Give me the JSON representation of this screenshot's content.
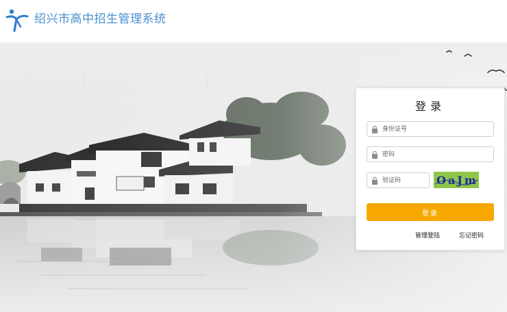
{
  "header": {
    "title": "绍兴市高中招生管理系统",
    "logo_icon": "person-leaping-logo",
    "brand_color": "#4a8fd0"
  },
  "login": {
    "title": "登录",
    "id_placeholder": "身份证号",
    "password_placeholder": "密码",
    "captcha_placeholder": "验证码",
    "captcha_text": "OaJm",
    "submit_label": "登录",
    "admin_link": "管理登陆",
    "forgot_link": "忘记密码",
    "accent_color": "#f6a800"
  }
}
